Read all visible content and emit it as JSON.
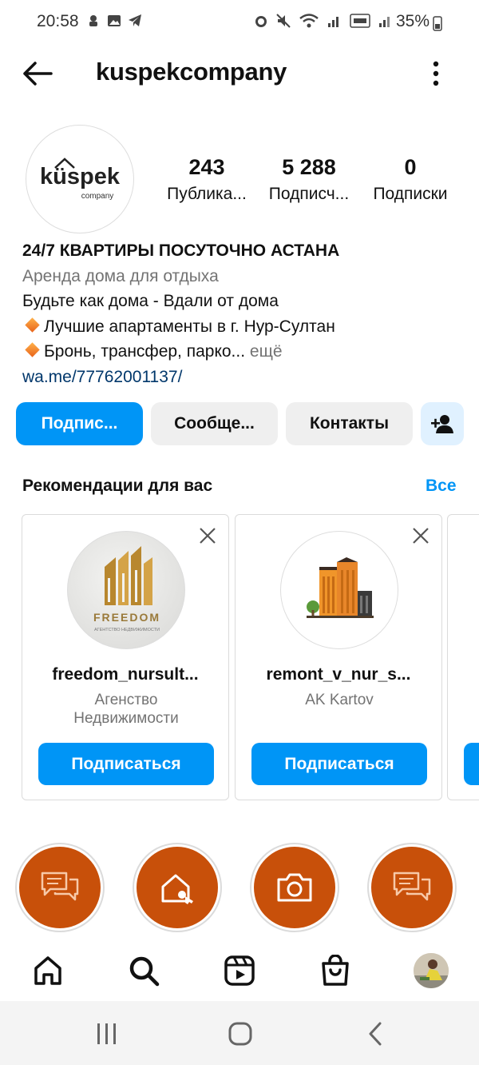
{
  "status_bar": {
    "time": "20:58",
    "battery": "35%"
  },
  "header": {
    "username": "kuspekcompany"
  },
  "profile": {
    "logo_text": "küspek",
    "logo_sub": "company",
    "stats": [
      {
        "value": "243",
        "label": "Публика..."
      },
      {
        "value": "5 288",
        "label": "Подписч..."
      },
      {
        "value": "0",
        "label": "Подписки"
      }
    ],
    "name": "24/7 КВАРТИРЫ ПОСУТОЧНО АСТАНА",
    "category": "Аренда дома для отдыха",
    "bio_line1": "Будьте как дома - Вдали от дома",
    "bio_line2": "Лучшие апартаменты в г. Нур-Султан",
    "bio_line3": "Бронь, трансфер, парко...",
    "more_label": " ещё",
    "link": "wa.me/77762001137/"
  },
  "actions": {
    "follow": "Подпис...",
    "message": "Сообще...",
    "contacts": "Контакты"
  },
  "suggestions": {
    "title": "Рекомендации для вас",
    "see_all": "Все",
    "cards": [
      {
        "username": "freedom_nursult...",
        "subtitle": "Агенство Недвижимости",
        "button": "Подписаться",
        "logo_text": "FREEDOM",
        "logo_sub": "АГЕНТСТВО НЕДВИЖИМОСТИ"
      },
      {
        "username": "remont_v_nur_s...",
        "subtitle": "AK Kartov",
        "button": "Подписаться"
      }
    ]
  },
  "highlights": [
    {
      "icon": "chat-bubbles-icon"
    },
    {
      "icon": "house-key-icon"
    },
    {
      "icon": "camera-icon"
    },
    {
      "icon": "chat-bubbles-icon"
    }
  ],
  "colors": {
    "accent": "#0095f6",
    "highlight_bg": "#c8500a"
  }
}
